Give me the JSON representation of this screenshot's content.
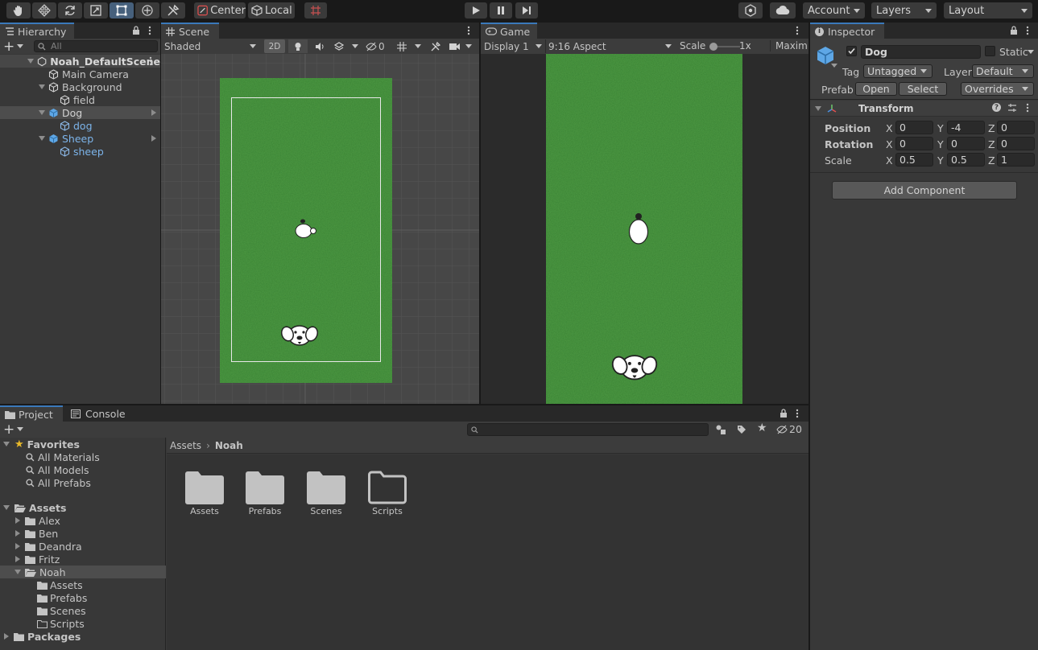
{
  "toolbar": {
    "tools": [
      "hand-tool",
      "move-tool",
      "rotate-tool",
      "scale-tool",
      "rect-tool",
      "transform-tool",
      "custom-tool"
    ],
    "pivot_label": "Center",
    "space_label": "Local",
    "account_label": "Account",
    "layers_label": "Layers",
    "layout_label": "Layout"
  },
  "hierarchy": {
    "tab": "Hierarchy",
    "search_placeholder": "All",
    "items": [
      {
        "label": "Noah_DefaultScene"
      },
      {
        "label": "Main Camera"
      },
      {
        "label": "Background"
      },
      {
        "label": "field"
      },
      {
        "label": "Dog"
      },
      {
        "label": "dog"
      },
      {
        "label": "Sheep"
      },
      {
        "label": "sheep"
      }
    ]
  },
  "scene": {
    "tab": "Scene",
    "shading": "Shaded",
    "mode_2d": "2D",
    "hidden_count": "0"
  },
  "game": {
    "tab": "Game",
    "display": "Display 1",
    "aspect": "9:16 Aspect",
    "scale_label": "Scale",
    "scale_value": "1x",
    "maximize": "Maximi"
  },
  "inspector": {
    "tab": "Inspector",
    "object_name": "Dog",
    "static_label": "Static",
    "tag_label": "Tag",
    "tag_value": "Untagged",
    "layer_label": "Layer",
    "layer_value": "Default",
    "prefab_label": "Prefab",
    "open_label": "Open",
    "select_label": "Select",
    "overrides_label": "Overrides",
    "component_title": "Transform",
    "position_label": "Position",
    "rotation_label": "Rotation",
    "scale_label": "Scale",
    "axis_x": "X",
    "axis_y": "Y",
    "axis_z": "Z",
    "position": {
      "x": "0",
      "y": "-4",
      "z": "0"
    },
    "rotation": {
      "x": "0",
      "y": "0",
      "z": "0"
    },
    "scale": {
      "x": "0.5",
      "y": "0.5",
      "z": "1"
    },
    "add_component": "Add Component"
  },
  "project": {
    "tab_project": "Project",
    "tab_console": "Console",
    "hidden_count": "20",
    "favorites_label": "Favorites",
    "favorites": [
      "All Materials",
      "All Models",
      "All Prefabs"
    ],
    "assets_label": "Assets",
    "asset_folders": [
      "Alex",
      "Ben",
      "Deandra",
      "Fritz",
      "Noah"
    ],
    "noah_children": [
      "Assets",
      "Prefabs",
      "Scenes",
      "Scripts"
    ],
    "packages_label": "Packages",
    "breadcrumb_root": "Assets",
    "breadcrumb_current": "Noah",
    "grid_items": [
      "Assets",
      "Prefabs",
      "Scenes",
      "Scripts"
    ]
  },
  "colors": {
    "accent": "#3a79bb",
    "grass": "#4e9a45",
    "prefab_blue": "#7cb4ea"
  }
}
